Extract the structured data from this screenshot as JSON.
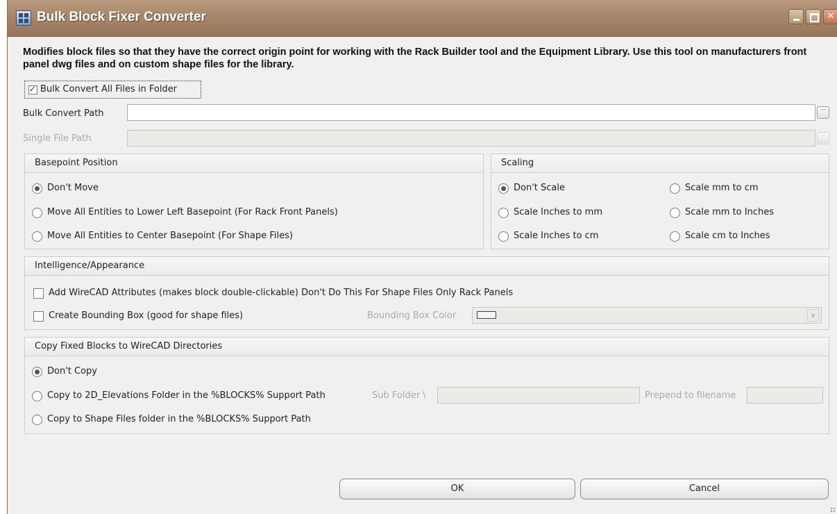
{
  "window": {
    "title": "Bulk Block Fixer Converter",
    "description": "Modifies block files so that they have the correct origin point for working with the Rack Builder tool and the Equipment Library. Use this tool on manufacturers front panel dwg files and on custom shape files for the library."
  },
  "bulk": {
    "checkbox_label": "Bulk Convert All Files in Folder",
    "checked": true,
    "path_label": "Bulk Convert Path",
    "path_value": "",
    "single_label": "Single File Path",
    "single_value": "",
    "browse_glyph": "···"
  },
  "basepoint": {
    "title": "Basepoint Position",
    "options": [
      {
        "label": "Don't Move",
        "selected": true
      },
      {
        "label": "Move All Entities to Lower Left Basepoint (For Rack Front Panels)",
        "selected": false
      },
      {
        "label": "Move All Entities to Center Basepoint (For Shape Files)",
        "selected": false
      }
    ]
  },
  "scaling": {
    "title": "Scaling",
    "options": [
      {
        "label": "Don't Scale",
        "selected": true
      },
      {
        "label": "Scale Inches to mm",
        "selected": false
      },
      {
        "label": "Scale Inches to cm",
        "selected": false
      },
      {
        "label": "Scale mm to cm",
        "selected": false
      },
      {
        "label": "Scale mm to Inches",
        "selected": false
      },
      {
        "label": "Scale cm to Inches",
        "selected": false
      }
    ]
  },
  "intelligence": {
    "title": "Intelligence/Appearance",
    "add_attributes_label": "Add WireCAD Attributes (makes block double-clickable) Don't Do This For Shape Files Only Rack Panels",
    "add_attributes_checked": false,
    "bounding_box_label": "Create Bounding Box (good for shape files)",
    "bounding_box_checked": false,
    "bounding_color_label": "Bounding Box Color",
    "combo_arrow": "∨"
  },
  "copy": {
    "title": "Copy Fixed Blocks to WireCAD Directories",
    "options": [
      {
        "label": "Don't Copy",
        "selected": true
      },
      {
        "label": "Copy to 2D_Elevations Folder in the %BLOCKS% Support Path",
        "selected": false
      },
      {
        "label": "Copy to Shape Files folder in the %BLOCKS% Support Path",
        "selected": false
      }
    ],
    "subfolder_label": "Sub Folder \\",
    "subfolder_value": "",
    "prepend_label": "Prepend to filename",
    "prepend_value": ""
  },
  "buttons": {
    "ok": "OK",
    "cancel": "Cancel"
  }
}
